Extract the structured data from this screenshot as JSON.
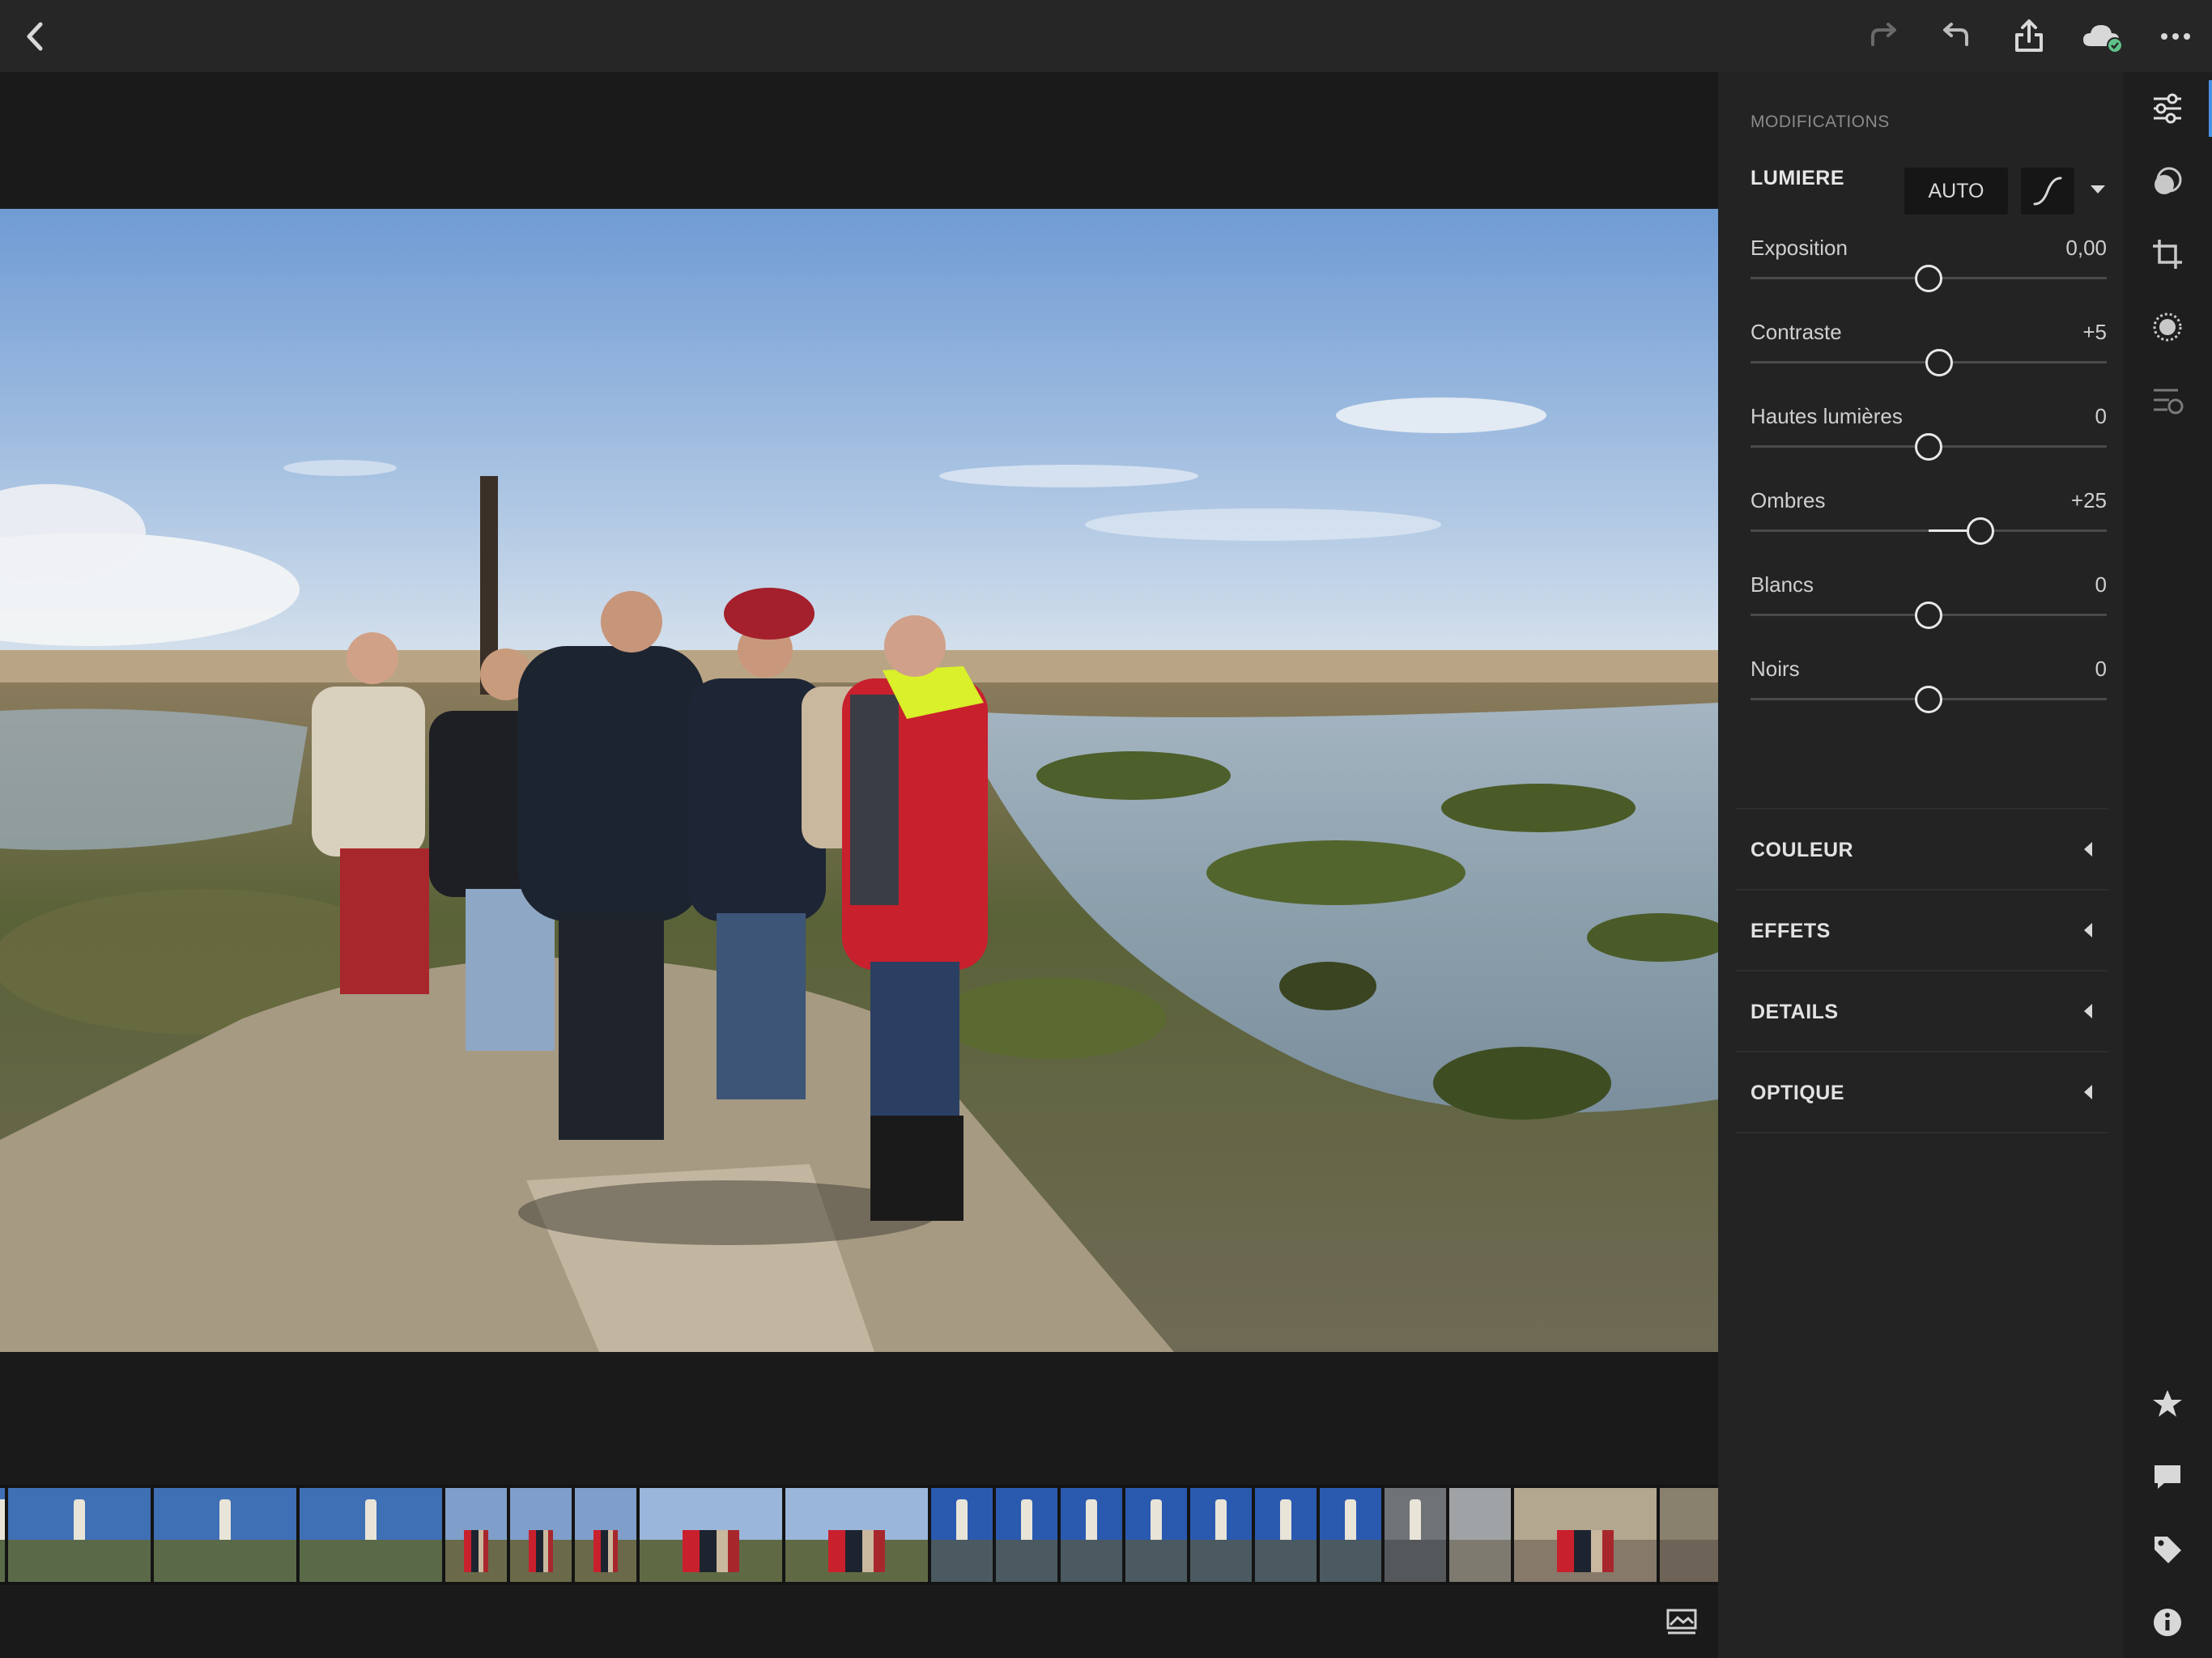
{
  "topbar": {
    "icons": [
      "back-icon",
      "redo-icon",
      "undo-icon",
      "share-icon",
      "cloud-sync-icon",
      "more-icon"
    ]
  },
  "panel": {
    "title": "MODIFICATIONS",
    "light": {
      "header": "LUMIERE",
      "auto_label": "AUTO",
      "sliders": [
        {
          "label": "Exposition",
          "value": "0,00",
          "fraction": 0.5
        },
        {
          "label": "Contraste",
          "value": "+5",
          "fraction": 0.53
        },
        {
          "label": "Hautes lumières",
          "value": "0",
          "fraction": 0.5
        },
        {
          "label": "Ombres",
          "value": "+25",
          "fraction": 0.645
        },
        {
          "label": "Blancs",
          "value": "0",
          "fraction": 0.5
        },
        {
          "label": "Noirs",
          "value": "0",
          "fraction": 0.5
        }
      ]
    },
    "sections": [
      {
        "label": "COULEUR"
      },
      {
        "label": "EFFETS"
      },
      {
        "label": "DETAILS"
      },
      {
        "label": "OPTIQUE"
      }
    ]
  },
  "right_toolbar": {
    "top_icons": [
      "edit-sliders-icon",
      "presets-icon",
      "crop-icon",
      "selective-brush-icon",
      "versions-icon"
    ],
    "bottom_icons": [
      "star-icon",
      "comment-icon",
      "tag-icon",
      "info-icon"
    ]
  },
  "bottombar": {
    "icons": [
      "compare-icon",
      "reset-icon"
    ]
  },
  "filmstrip": {
    "selected_index": 7,
    "thumbs": [
      {
        "type": "lighthouse-far",
        "w": 6
      },
      {
        "type": "lighthouse-far",
        "w": 176
      },
      {
        "type": "lighthouse-far",
        "w": 176
      },
      {
        "type": "lighthouse-far",
        "w": 176
      },
      {
        "type": "people-red",
        "w": 76
      },
      {
        "type": "people-red",
        "w": 76
      },
      {
        "type": "people-red",
        "w": 76
      },
      {
        "type": "group-beach",
        "w": 176
      },
      {
        "type": "group-beach",
        "w": 176
      },
      {
        "type": "lighthouse-blue",
        "w": 76
      },
      {
        "type": "lighthouse-blue",
        "w": 76
      },
      {
        "type": "lighthouse-blue",
        "w": 76
      },
      {
        "type": "lighthouse-blue",
        "w": 76
      },
      {
        "type": "lighthouse-blue",
        "w": 76
      },
      {
        "type": "lighthouse-blue",
        "w": 76
      },
      {
        "type": "lighthouse-blue",
        "w": 76
      },
      {
        "type": "lighthouse-grey",
        "w": 76
      },
      {
        "type": "wall",
        "w": 76
      },
      {
        "type": "doorway-people",
        "w": 176
      },
      {
        "type": "doorway",
        "w": 76
      }
    ]
  }
}
